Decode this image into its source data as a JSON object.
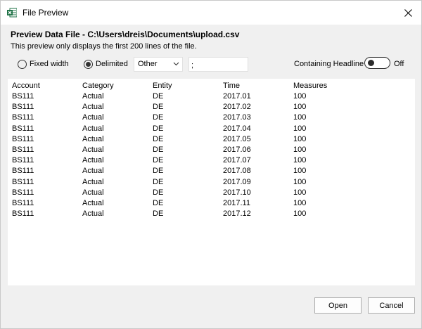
{
  "window": {
    "title": "File Preview",
    "app_icon": "excel-icon",
    "close_icon": "close-icon"
  },
  "header": {
    "title": "Preview Data File - C:\\Users\\dreis\\Documents\\upload.csv",
    "subtitle": "This preview only displays the first 200 lines of the file."
  },
  "options": {
    "fixed_width_label": "Fixed width",
    "delimited_label": "Delimited",
    "selected_mode": "Delimited",
    "delimiter_select_value": "Other",
    "delimiter_input_value": ";",
    "containing_headline_label": "Containing Headline",
    "toggle_state_label": "Off",
    "toggle_on": false
  },
  "table": {
    "headers": [
      "Account",
      "Category",
      "Entity",
      "Time",
      "Measures"
    ],
    "rows": [
      [
        "BS111",
        "Actual",
        "DE",
        "2017.01",
        "100"
      ],
      [
        "BS111",
        "Actual",
        "DE",
        "2017.02",
        "100"
      ],
      [
        "BS111",
        "Actual",
        "DE",
        "2017.03",
        "100"
      ],
      [
        "BS111",
        "Actual",
        "DE",
        "2017.04",
        "100"
      ],
      [
        "BS111",
        "Actual",
        "DE",
        "2017.05",
        "100"
      ],
      [
        "BS111",
        "Actual",
        "DE",
        "2017.06",
        "100"
      ],
      [
        "BS111",
        "Actual",
        "DE",
        "2017.07",
        "100"
      ],
      [
        "BS111",
        "Actual",
        "DE",
        "2017.08",
        "100"
      ],
      [
        "BS111",
        "Actual",
        "DE",
        "2017.09",
        "100"
      ],
      [
        "BS111",
        "Actual",
        "DE",
        "2017.10",
        "100"
      ],
      [
        "BS111",
        "Actual",
        "DE",
        "2017.11",
        "100"
      ],
      [
        "BS111",
        "Actual",
        "DE",
        "2017.12",
        "100"
      ]
    ]
  },
  "buttons": {
    "open_label": "Open",
    "cancel_label": "Cancel"
  },
  "colors": {
    "excel_green": "#1e7145",
    "dialog_bg": "#f0f0f0"
  }
}
